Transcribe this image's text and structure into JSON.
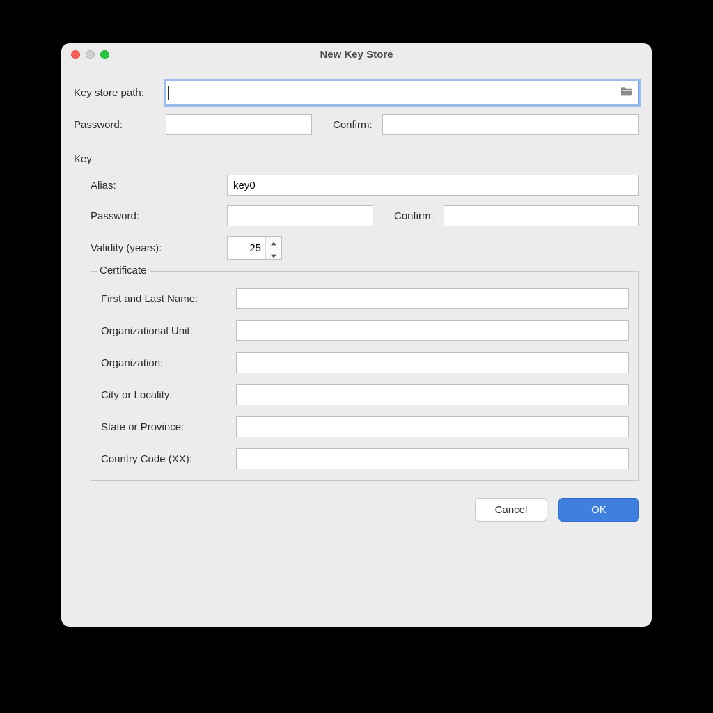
{
  "window": {
    "title": "New Key Store"
  },
  "keystore": {
    "path_label": "Key store path:",
    "path_value": "",
    "password_label": "Password:",
    "password_value": "",
    "confirm_label": "Confirm:",
    "confirm_value": ""
  },
  "key_section": {
    "heading": "Key",
    "alias_label": "Alias:",
    "alias_value": "key0",
    "password_label": "Password:",
    "password_value": "",
    "confirm_label": "Confirm:",
    "confirm_value": "",
    "validity_label": "Validity (years):",
    "validity_value": "25"
  },
  "certificate": {
    "legend": "Certificate",
    "fields": {
      "name_label": "First and Last Name:",
      "name_value": "",
      "ou_label": "Organizational Unit:",
      "ou_value": "",
      "org_label": "Organization:",
      "org_value": "",
      "city_label": "City or Locality:",
      "city_value": "",
      "state_label": "State or Province:",
      "state_value": "",
      "cc_label": "Country Code (XX):",
      "cc_value": ""
    }
  },
  "buttons": {
    "cancel": "Cancel",
    "ok": "OK"
  }
}
